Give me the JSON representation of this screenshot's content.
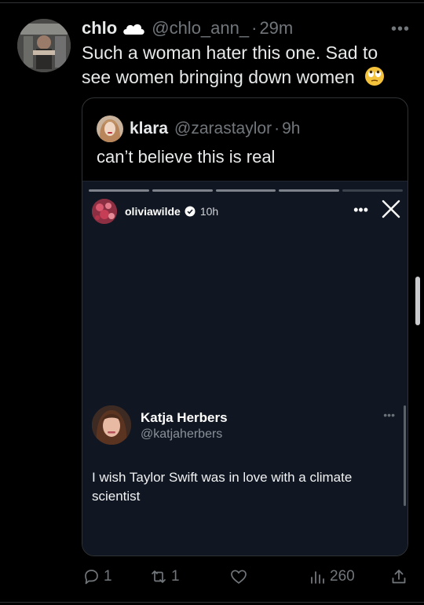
{
  "tweet": {
    "name": "chlo",
    "handle": "@chlo_ann_",
    "dot": "·",
    "time": "29m",
    "more": "•••",
    "text": "Such a woman hater this one. Sad to see women bringing down women"
  },
  "quote": {
    "name": "klara",
    "handle": "@zarastaylor",
    "dot": "·",
    "time": "9h",
    "text": "can’t believe this is real"
  },
  "story": {
    "username": "oliviawilde",
    "time": "10h",
    "more": "•••",
    "post": {
      "name": "Katja Herbers",
      "handle": "@katjaherbers",
      "more": "•••",
      "text": "I wish Taylor Swift was in love with a climate scientist"
    }
  },
  "actions": {
    "replies": "1",
    "reposts": "1",
    "likes": "",
    "views": "260"
  },
  "colors": {
    "background": "#000000",
    "muted_text": "#71767b",
    "story_background": "#101722"
  }
}
